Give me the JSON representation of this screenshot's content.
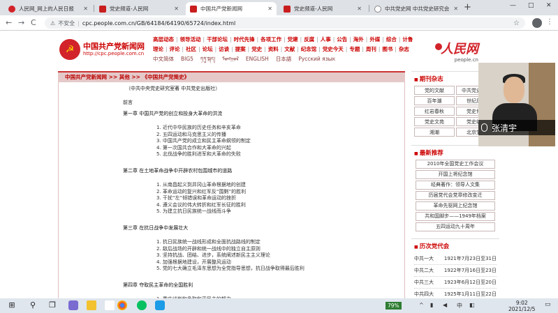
{
  "tabs": [
    {
      "title": "人民网_网上的人民日报",
      "active": false
    },
    {
      "title": "党史频道-人民网",
      "active": false
    },
    {
      "title": "中国共产党新闻网",
      "active": true
    },
    {
      "title": "党史频道-人民网",
      "active": false
    },
    {
      "title": "中共党史网 中共党史研究会",
      "active": false
    }
  ],
  "new_tab": "+",
  "window_controls": {
    "minimize": "—",
    "maximize": "□",
    "close": "✕"
  },
  "toolbar": {
    "back": "←",
    "forward": "→",
    "reload": "C",
    "warning_icon": "⚠",
    "insecure_label": "不安全",
    "url": "cpc.people.com.cn/GB/64184/64190/65724/index.html",
    "star": "☆",
    "menu": "⋮"
  },
  "site": {
    "emblem": "☭",
    "title": "中国共产党新闻网",
    "url": "http://cpc.people.com.cn",
    "nav_row1": [
      "高层动态",
      "领导活动",
      "干部论坛",
      "时代先锋",
      "各项工作",
      "党建",
      "反腐",
      "人事",
      "公告",
      "海外",
      "外媒",
      "综合",
      "计鲁"
    ],
    "nav_row2": [
      "理论",
      "评论",
      "社区",
      "论坛",
      "访谈",
      "提案",
      "党史",
      "资料",
      "文献",
      "纪念馆",
      "党史今天",
      "专题",
      "周刊",
      "图书",
      "杂志"
    ],
    "languages": [
      "中文简体",
      "BIG5",
      "ཏཏུ་སྐད།",
      "ᠮᠣᠩᠭᠣᠯ",
      "ENGLISH",
      "日本語",
      "Pусский язык"
    ],
    "people_logo": "人民网",
    "people_url": "people.cn"
  },
  "breadcrumb": "中国共产党新闻网 >> 其他 >> 《中国共产党简史》",
  "content": {
    "publisher": "（中共中央党史研究室著 中共党史出版社）",
    "preface": "前言",
    "chapters": [
      {
        "title": "第一章   中国共产党的创立和投身大革命的洪流",
        "items": [
          "1. 近代中华民族的历史任务和辛亥革命",
          "2. 五四运动和马克思主义的传播",
          "3. 中国共产党的成立和民主革命纲领的制定",
          "4. 第一次国共合作和大革命的兴起",
          "5. 北伐战争的胜利进军和大革命的失败"
        ]
      },
      {
        "title": "第二章   在土地革命战争中开辟农村包围城市的道路",
        "items": [
          "1. 从南昌起义到井冈山革命根据地的创建",
          "2. 革命运动的复兴和红军反“围剿”的胜利",
          "3. 干扰“左”倾错误和革命运动的挫折",
          "4. 遵义会议的伟大转折和红军长征的胜利",
          "5. 为建立抗日民族统一战线而斗争"
        ]
      },
      {
        "title": "第三章   在抗日战争中发展壮大",
        "items": [
          "1. 抗日民族统一战线形成和全面抗战路线的制定",
          "2. 敌后战场的开辟和统一战线中的独立自主原则",
          "3. 坚持抗战、团结、进步，系统阐述新民主主义理论",
          "4. 加强根据地建设，开展整风运动",
          "5. 党的七大确立毛泽东思想为全党指导思想，抗日战争取得最后胜利"
        ]
      },
      {
        "title": "第四章   夺取民主革命的全国胜利",
        "items": [
          "1. 重庆谈判和争取和平民主的努力",
          "2. 以自卫战争粉碎国民党的军事进攻和开辟第二条战线的斗争"
        ]
      }
    ]
  },
  "sidebar": {
    "magazines_title": "期刊杂志",
    "magazines": [
      "党的文献",
      "中共党史研究",
      "百年潮",
      "世纪风采",
      "红岩春秋",
      "党史博览",
      "党史文苑",
      "党史纵览",
      "湘潮",
      "北京党史"
    ],
    "recommend_title": "最新推荐",
    "recommend": [
      "2010年全国党史工作会议",
      "开国上将纪念馆",
      "经典著作：领导人文集",
      "历届党代会党章修改变迁",
      "革命先驱网上纪念馆",
      "共和国脚步——1949年档案",
      "五四运动九十周年"
    ],
    "congress_title": "历次党代会",
    "congress": [
      {
        "name": "中共一大",
        "date": "1921年7月23日至31日"
      },
      {
        "name": "中共二大",
        "date": "1922年7月16日至23日"
      },
      {
        "name": "中共三大",
        "date": "1923年6月12日至20日"
      },
      {
        "name": "中共四大",
        "date": "1925年1月11日至22日"
      }
    ]
  },
  "video": {
    "name": "张清宇"
  },
  "taskbar": {
    "start": "⊞",
    "search": "⚲",
    "taskview": "❐",
    "battery": "79%",
    "tray_arrow": "^",
    "lang": "中",
    "time": "9:02",
    "date": "2021/12/5",
    "notif": "▭"
  },
  "colors": {
    "accent": "#c00000",
    "breadcrumb_bg": "#e5c9c9"
  }
}
